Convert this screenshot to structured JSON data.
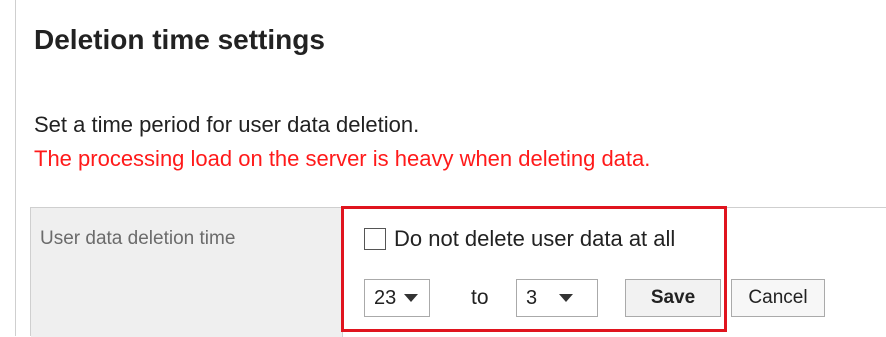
{
  "page": {
    "title": "Deletion time settings",
    "description": "Set a time period for user data deletion.",
    "warning": "The processing load on the server is heavy when deleting data."
  },
  "form": {
    "row_label": "User data deletion time",
    "checkbox_label": "Do not delete user data at all",
    "checkbox_checked": false,
    "start_hour": "23",
    "to_label": "to",
    "end_hour": "3",
    "save_label": "Save",
    "cancel_label": "Cancel"
  },
  "colors": {
    "warning": "#ff1a1a",
    "highlight_border": "#e0141e",
    "label_cell_bg": "#efefef"
  }
}
